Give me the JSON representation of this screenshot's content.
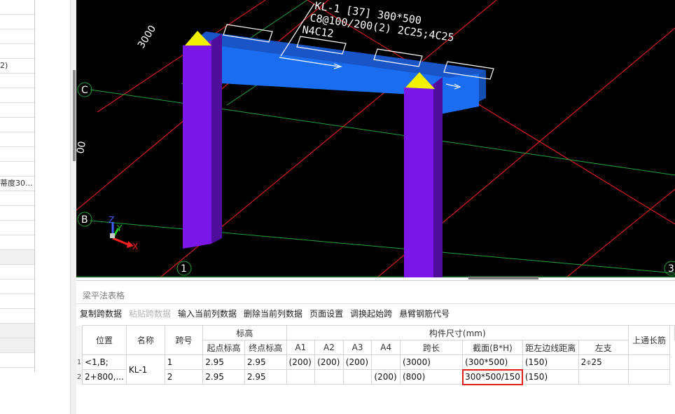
{
  "left_panel": {
    "rows": [
      "",
      "",
      "",
      "",
      "2)",
      "",
      "",
      "",
      "",
      "",
      "",
      "",
      "蒂度30...",
      "",
      "",
      "",
      "",
      "",
      "",
      "",
      "",
      "",
      "",
      "",
      ""
    ]
  },
  "viewport": {
    "grid_labels": {
      "axis_c": "C",
      "axis_b": "B",
      "axis_1": "1",
      "axis_3": "3",
      "dim_3000": "3000",
      "dim_left": "00"
    },
    "annotation_lines": [
      "KL-1 [37] 300*500",
      "C8@100/200(2) 2C25;4C25",
      "N4C12"
    ],
    "axes": {
      "z": "Z",
      "y": "Y",
      "x": "X"
    },
    "colors": {
      "beam": "#1a6df0",
      "column": "#7a16e8",
      "cap": "#f2f200",
      "grid_red": "#ff2020",
      "grid_green": "#23a23a"
    }
  },
  "table_pane": {
    "title": "梁平法表格",
    "toolbar": {
      "copy_span": "复制跨数据",
      "paste_span": "粘贴跨数据",
      "input_col": "输入当前列数据",
      "delete_col": "删除当前列数据",
      "page_setup": "页面设置",
      "swap_span": "调换起始跨",
      "cantilever": "悬臂钢筋代号"
    },
    "headers": {
      "position": "位置",
      "name": "名称",
      "span_no": "跨号",
      "elevation": "标高",
      "start_elev": "起点标高",
      "end_elev": "终点标高",
      "dimensions": "构件尺寸(mm)",
      "a1": "A1",
      "a2": "A2",
      "a3": "A3",
      "a4": "A4",
      "span_len": "跨长",
      "section": "截面(B*H)",
      "offset": "距左边线距离",
      "top_long": "上通长筋",
      "left_support": "左支"
    },
    "rows": [
      {
        "num": "1",
        "position": "<1,B;",
        "name": "KL-1",
        "span": "1",
        "start": "2.95",
        "end": "2.95",
        "a1": "(200)",
        "a2": "(200)",
        "a3": "(200)",
        "a4": "",
        "span_len": "(3000)",
        "section": "(300*500)",
        "offset": "(150)",
        "top_long": "2⌽25",
        "left": ""
      },
      {
        "num": "2",
        "position": "2+800,...",
        "name": "",
        "span": "2",
        "start": "2.95",
        "end": "2.95",
        "a1": "",
        "a2": "",
        "a3": "",
        "a4": "(200)",
        "span_len": "(800)",
        "section": "300*500/150",
        "offset": "(150)",
        "top_long": "",
        "left": ""
      }
    ]
  }
}
